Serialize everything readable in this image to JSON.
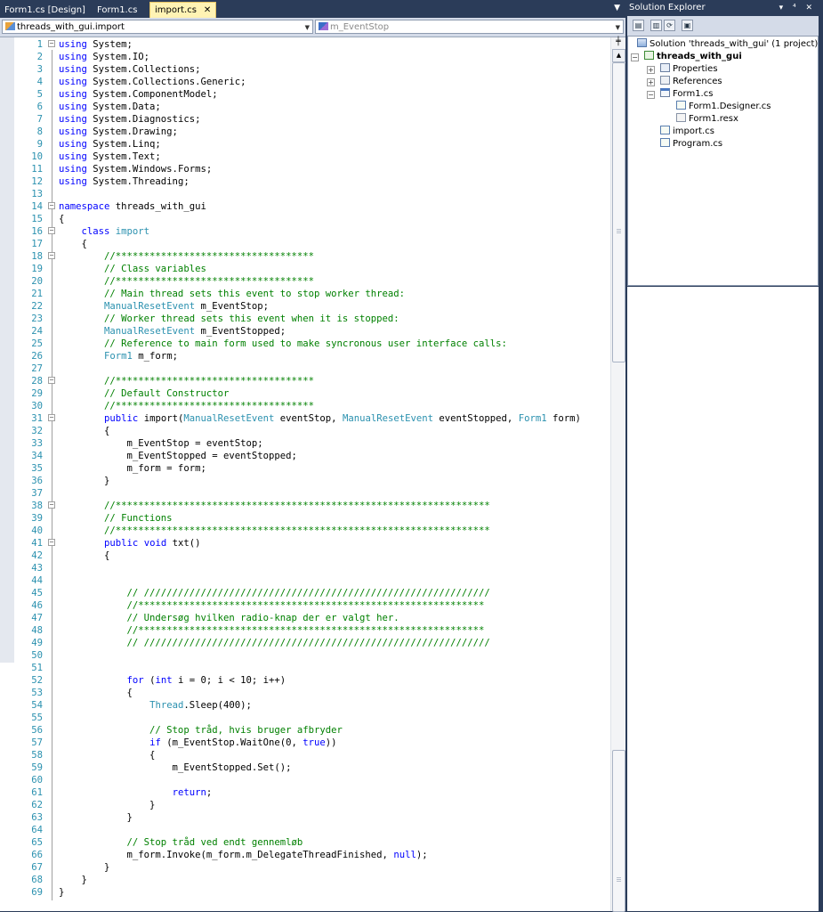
{
  "tabs": [
    {
      "label": "Form1.cs [Design]",
      "active": false
    },
    {
      "label": "Form1.cs",
      "active": false
    },
    {
      "label": "import.cs",
      "active": true
    }
  ],
  "tab_close_glyph": "✕",
  "tab_dropdown_glyph": "▼",
  "navbar": {
    "type_combo": "threads_with_gui.import",
    "member_combo": "m_EventStop"
  },
  "code_lines": [
    [
      {
        "t": "using",
        "c": "k"
      },
      {
        "t": " System;"
      }
    ],
    [
      {
        "t": "using",
        "c": "k"
      },
      {
        "t": " System.IO;"
      }
    ],
    [
      {
        "t": "using",
        "c": "k"
      },
      {
        "t": " System.Collections;"
      }
    ],
    [
      {
        "t": "using",
        "c": "k"
      },
      {
        "t": " System.Collections.Generic;"
      }
    ],
    [
      {
        "t": "using",
        "c": "k"
      },
      {
        "t": " System.ComponentModel;"
      }
    ],
    [
      {
        "t": "using",
        "c": "k"
      },
      {
        "t": " System.Data;"
      }
    ],
    [
      {
        "t": "using",
        "c": "k"
      },
      {
        "t": " System.Diagnostics;"
      }
    ],
    [
      {
        "t": "using",
        "c": "k"
      },
      {
        "t": " System.Drawing;"
      }
    ],
    [
      {
        "t": "using",
        "c": "k"
      },
      {
        "t": " System.Linq;"
      }
    ],
    [
      {
        "t": "using",
        "c": "k"
      },
      {
        "t": " System.Text;"
      }
    ],
    [
      {
        "t": "using",
        "c": "k"
      },
      {
        "t": " System.Windows.Forms;"
      }
    ],
    [
      {
        "t": "using",
        "c": "k"
      },
      {
        "t": " System.Threading;"
      }
    ],
    [],
    [
      {
        "t": "namespace",
        "c": "k"
      },
      {
        "t": " threads_with_gui"
      }
    ],
    [
      {
        "t": "{"
      }
    ],
    [
      {
        "t": "    "
      },
      {
        "t": "class",
        "c": "k"
      },
      {
        "t": " "
      },
      {
        "t": "import",
        "c": "t"
      }
    ],
    [
      {
        "t": "    {"
      }
    ],
    [
      {
        "t": "        //***********************************",
        "c": "c"
      }
    ],
    [
      {
        "t": "        // Class variables",
        "c": "c"
      }
    ],
    [
      {
        "t": "        //***********************************",
        "c": "c"
      }
    ],
    [
      {
        "t": "        // Main thread sets this event to stop worker thread:",
        "c": "c"
      }
    ],
    [
      {
        "t": "        "
      },
      {
        "t": "ManualResetEvent",
        "c": "t"
      },
      {
        "t": " m_EventStop;"
      }
    ],
    [
      {
        "t": "        // Worker thread sets this event when it is stopped:",
        "c": "c"
      }
    ],
    [
      {
        "t": "        "
      },
      {
        "t": "ManualResetEvent",
        "c": "t"
      },
      {
        "t": " m_EventStopped;"
      }
    ],
    [
      {
        "t": "        // Reference to main form used to make syncronous user interface calls:",
        "c": "c"
      }
    ],
    [
      {
        "t": "        "
      },
      {
        "t": "Form1",
        "c": "t"
      },
      {
        "t": " m_form;"
      }
    ],
    [],
    [
      {
        "t": "        //***********************************",
        "c": "c"
      }
    ],
    [
      {
        "t": "        // Default Constructor",
        "c": "c"
      }
    ],
    [
      {
        "t": "        //***********************************",
        "c": "c"
      }
    ],
    [
      {
        "t": "        "
      },
      {
        "t": "public",
        "c": "k"
      },
      {
        "t": " import("
      },
      {
        "t": "ManualResetEvent",
        "c": "t"
      },
      {
        "t": " eventStop, "
      },
      {
        "t": "ManualResetEvent",
        "c": "t"
      },
      {
        "t": " eventStopped, "
      },
      {
        "t": "Form1",
        "c": "t"
      },
      {
        "t": " form)"
      }
    ],
    [
      {
        "t": "        {"
      }
    ],
    [
      {
        "t": "            m_EventStop = eventStop;"
      }
    ],
    [
      {
        "t": "            m_EventStopped = eventStopped;"
      }
    ],
    [
      {
        "t": "            m_form = form;"
      }
    ],
    [
      {
        "t": "        }"
      }
    ],
    [],
    [
      {
        "t": "        //******************************************************************",
        "c": "c"
      }
    ],
    [
      {
        "t": "        // Functions",
        "c": "c"
      }
    ],
    [
      {
        "t": "        //******************************************************************",
        "c": "c"
      }
    ],
    [
      {
        "t": "        "
      },
      {
        "t": "public",
        "c": "k"
      },
      {
        "t": " "
      },
      {
        "t": "void",
        "c": "k"
      },
      {
        "t": " txt()"
      }
    ],
    [
      {
        "t": "        {"
      }
    ],
    [],
    [],
    [
      {
        "t": "            // /////////////////////////////////////////////////////////////",
        "c": "c"
      }
    ],
    [
      {
        "t": "            //*************************************************************",
        "c": "c"
      }
    ],
    [
      {
        "t": "            // Undersøg hvilken radio-knap der er valgt her.",
        "c": "c"
      }
    ],
    [
      {
        "t": "            //*************************************************************",
        "c": "c"
      }
    ],
    [
      {
        "t": "            // /////////////////////////////////////////////////////////////",
        "c": "c"
      }
    ],
    [],
    [],
    [
      {
        "t": "            "
      },
      {
        "t": "for",
        "c": "k"
      },
      {
        "t": " ("
      },
      {
        "t": "int",
        "c": "k"
      },
      {
        "t": " i = 0; i < 10; i++)"
      }
    ],
    [
      {
        "t": "            {"
      }
    ],
    [
      {
        "t": "                "
      },
      {
        "t": "Thread",
        "c": "t"
      },
      {
        "t": ".Sleep(400);"
      }
    ],
    [],
    [
      {
        "t": "                // Stop tråd, hvis bruger afbryder",
        "c": "c"
      }
    ],
    [
      {
        "t": "                "
      },
      {
        "t": "if",
        "c": "k"
      },
      {
        "t": " (m_EventStop.WaitOne(0, "
      },
      {
        "t": "true",
        "c": "k"
      },
      {
        "t": "))"
      }
    ],
    [
      {
        "t": "                {"
      }
    ],
    [
      {
        "t": "                    m_EventStopped.Set();"
      }
    ],
    [],
    [
      {
        "t": "                    "
      },
      {
        "t": "return",
        "c": "k"
      },
      {
        "t": ";"
      }
    ],
    [
      {
        "t": "                }"
      }
    ],
    [
      {
        "t": "            }"
      }
    ],
    [],
    [
      {
        "t": "            // Stop tråd ved endt gennemløb",
        "c": "c"
      }
    ],
    [
      {
        "t": "            m_form.Invoke(m_form.m_DelegateThreadFinished, "
      },
      {
        "t": "null",
        "c": "k"
      },
      {
        "t": ");"
      }
    ],
    [
      {
        "t": "        }"
      }
    ],
    [
      {
        "t": "    }"
      }
    ],
    [
      {
        "t": "}"
      }
    ]
  ],
  "fold_lines": [
    1,
    14,
    16,
    18,
    28,
    31,
    38,
    41
  ],
  "solution_explorer": {
    "title": "Solution Explorer",
    "title_buttons": "▾ ⁴ ✕",
    "toolbar": [
      "▤",
      "▥",
      "⟳",
      "▣"
    ],
    "nodes": [
      {
        "label": "Solution 'threads_with_gui' (1 project)",
        "level": 0,
        "icon": "solution-icon",
        "bold": false,
        "exp": ""
      },
      {
        "label": "threads_with_gui",
        "level": 1,
        "icon": "csharp-project-icon",
        "bold": true,
        "exp": "−"
      },
      {
        "label": "Properties",
        "level": 2,
        "icon": "properties-icon",
        "bold": false,
        "exp": "+"
      },
      {
        "label": "References",
        "level": 2,
        "icon": "references-icon",
        "bold": false,
        "exp": "+"
      },
      {
        "label": "Form1.cs",
        "level": 2,
        "icon": "form-icon",
        "bold": false,
        "exp": "−"
      },
      {
        "label": "Form1.Designer.cs",
        "level": 3,
        "icon": "cs-file-icon",
        "bold": false,
        "exp": ""
      },
      {
        "label": "Form1.resx",
        "level": 3,
        "icon": "resx-file-icon",
        "bold": false,
        "exp": ""
      },
      {
        "label": "import.cs",
        "level": 2,
        "icon": "cs-file-icon",
        "bold": false,
        "exp": ""
      },
      {
        "label": "Program.cs",
        "level": 2,
        "icon": "cs-file-icon",
        "bold": false,
        "exp": ""
      }
    ]
  },
  "colors": {
    "keyword": "#0000ff",
    "comment": "#008000",
    "type": "#2b91af",
    "line_number": "#2b91af",
    "chrome": "#2b3c59",
    "active_tab": "#fff3b4"
  }
}
